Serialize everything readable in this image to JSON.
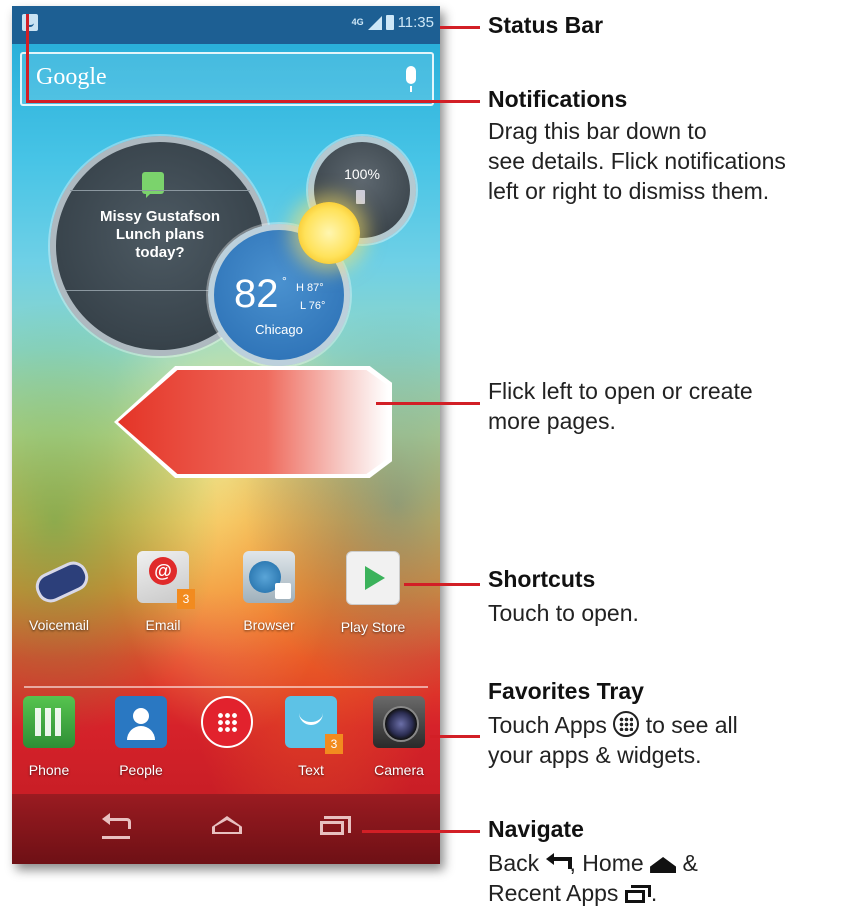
{
  "status_bar": {
    "network": "4G",
    "time": "11:35"
  },
  "search": {
    "logo_text": "Google"
  },
  "message_widget": {
    "sender": "Missy Gustafson",
    "message_line1": "Lunch plans",
    "message_line2": "today?"
  },
  "battery_widget": {
    "level": "100%"
  },
  "weather_widget": {
    "temp": "82",
    "degree": "°",
    "high": "H 87°",
    "low": "L 76°",
    "city": "Chicago"
  },
  "shortcuts": [
    {
      "label": "Voicemail",
      "icon": "voicemail-icon"
    },
    {
      "label": "Email",
      "icon": "email-icon",
      "badge": "3"
    },
    {
      "label": "Browser",
      "icon": "browser-icon"
    },
    {
      "label": "Play Store",
      "icon": "play-store-icon"
    }
  ],
  "favorites": [
    {
      "label": "Phone",
      "icon": "phone-icon"
    },
    {
      "label": "People",
      "icon": "people-icon"
    },
    {
      "label": "",
      "icon": "apps-grid-icon"
    },
    {
      "label": "Text",
      "icon": "text-message-icon",
      "badge": "3"
    },
    {
      "label": "Camera",
      "icon": "camera-icon"
    }
  ],
  "callouts": {
    "status_bar": {
      "title": "Status Bar"
    },
    "notifications": {
      "title": "Notifications",
      "line1": "Drag this bar down to",
      "line2": "see details. Flick notifications",
      "line3": "left or right to dismiss them."
    },
    "flick": {
      "line1": "Flick left to open or create",
      "line2": "more pages."
    },
    "shortcuts": {
      "title": "Shortcuts",
      "line1": "Touch to open."
    },
    "favorites": {
      "title": "Favorites Tray",
      "line1_pre": "Touch Apps",
      "line1_post": "to see all",
      "line2": "your apps & widgets."
    },
    "navigate": {
      "title": "Navigate",
      "back_label": "Back",
      "home_label": ", Home",
      "amp": "&",
      "recent_label": "Recent Apps",
      "end": "."
    }
  },
  "colors": {
    "leader": "#d21f26",
    "status_bar_bg": "#1d5f93",
    "nav_bar_bg": "#7e1319"
  }
}
